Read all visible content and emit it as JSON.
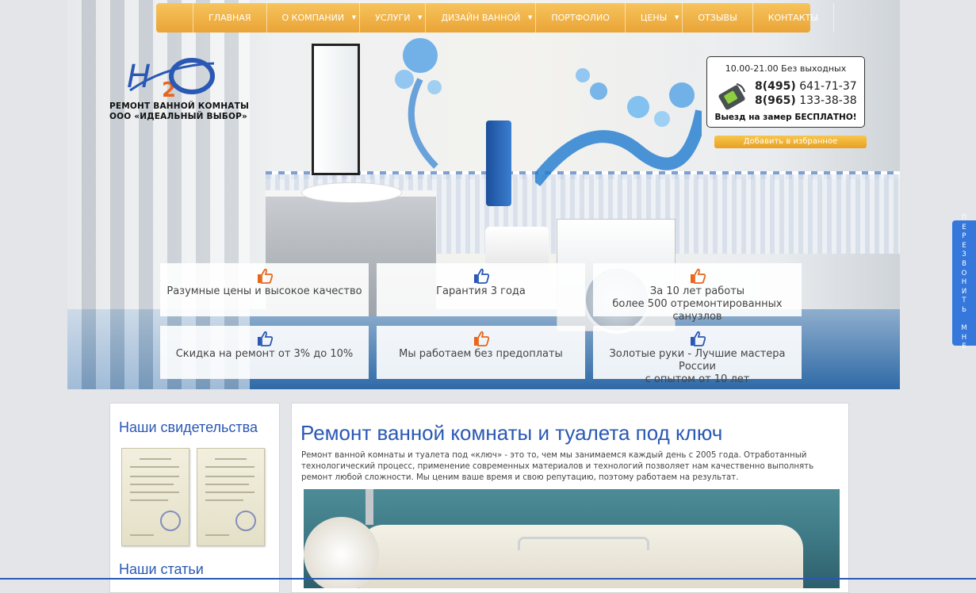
{
  "nav": {
    "items": [
      {
        "label": "Главная",
        "has_submenu": false
      },
      {
        "label": "О компании",
        "has_submenu": true
      },
      {
        "label": "Услуги",
        "has_submenu": true
      },
      {
        "label": "Дизайн ванной",
        "has_submenu": true
      },
      {
        "label": "Портфолио",
        "has_submenu": false
      },
      {
        "label": "Цены",
        "has_submenu": true
      },
      {
        "label": "Отзывы",
        "has_submenu": false
      },
      {
        "label": "Контакты",
        "has_submenu": false
      }
    ]
  },
  "logo": {
    "mark": "H2O",
    "line1": "РЕМОНТ ВАННОЙ КОМНАТЫ",
    "line2": "ООО «ИДЕАЛЬНЫЙ ВЫБОР»"
  },
  "contact": {
    "hours": "10.00-21.00 Без выходных",
    "phone1_code": "8(495)",
    "phone1_number": "641-71-37",
    "phone2_code": "8(965)",
    "phone2_number": "133-38-38",
    "visit": "Выезд на замер БЕСПЛАТНО!",
    "favorite_button": "Добавить в избранное"
  },
  "features": [
    {
      "line1": "Разумные цены и высокое качество",
      "line2": "",
      "icon": "thumbs-up-icon",
      "color": "#e8661c"
    },
    {
      "line1": "Гарантия 3 года",
      "line2": "",
      "icon": "thumbs-up-icon",
      "color": "#2a58b5"
    },
    {
      "line1": "За 10 лет работы",
      "line2": "более 500 отремонтированных санузлов",
      "icon": "thumbs-up-icon",
      "color": "#e8661c"
    },
    {
      "line1": "Скидка на ремонт от 3% до 10%",
      "line2": "",
      "icon": "thumbs-up-icon",
      "color": "#2a58b5"
    },
    {
      "line1": "Мы работаем без предоплаты",
      "line2": "",
      "icon": "thumbs-up-icon",
      "color": "#e8661c"
    },
    {
      "line1": "Золотые руки - Лучшие мастера России",
      "line2": "с опытом от 10 лет",
      "icon": "thumbs-up-icon",
      "color": "#2a58b5"
    }
  ],
  "callback": {
    "letters": [
      "П",
      "Е",
      "Р",
      "Е",
      "З",
      "В",
      "О",
      "Н",
      "И",
      "Т",
      "Ь",
      "",
      "М",
      "Н",
      "Е"
    ]
  },
  "sidebar": {
    "certificates_title": "Наши свидетельства",
    "articles_title": "Наши статьи"
  },
  "main": {
    "title": "Ремонт ванной комнаты и туалета под ключ",
    "intro": "Ремонт ванной комнаты и туалета под «ключ» - это то, чем мы занимаемся каждый день с 2005 года. Отработанный технологический процесс, применение современных материалов и технологий позволяет нам качественно выполнять ремонт любой сложности. Мы ценим ваше время и свою репутацию, поэтому работаем на результат."
  },
  "colors": {
    "nav": "#eeae40",
    "heading": "#2a58b5",
    "callback": "#3577db",
    "accent_orange": "#e8661c"
  }
}
